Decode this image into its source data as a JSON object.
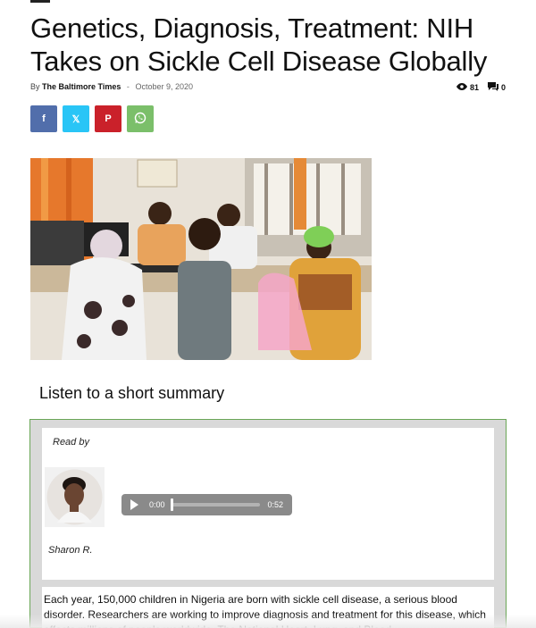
{
  "article": {
    "headline": "Genetics, Diagnosis, Treatment: NIH Takes on Sickle Cell Disease Globally",
    "by_label": "By",
    "author": "The Baltimore Times",
    "separator": "-",
    "date": "October 9, 2020",
    "views": "81",
    "comments": "0"
  },
  "share": {
    "facebook": "f",
    "x": "𝕏",
    "pinterest": "P",
    "whatsapp": "W"
  },
  "icons": {
    "views": "eye-icon",
    "comments": "comment-icon",
    "play": "play-icon"
  },
  "colors": {
    "facebook": "#516eab",
    "x": "#29c5f6",
    "pinterest": "#ca212a",
    "whatsapp": "#7bbf6a",
    "player_border": "#6aa657"
  },
  "audio_summary": {
    "title": "Listen to a short summary",
    "read_by": "Read by",
    "reader_name": "Sharon R.",
    "current_time": "0:00",
    "duration": "0:52",
    "progress": 0
  },
  "summary_text": "Each year, 150,000 children in Nigeria are born with sickle cell disease, a serious blood disorder. Researchers are working to improve diagnosis and treatment for this disease, which affects millions of people worldwide. The National Heart, Lung, and Blood"
}
